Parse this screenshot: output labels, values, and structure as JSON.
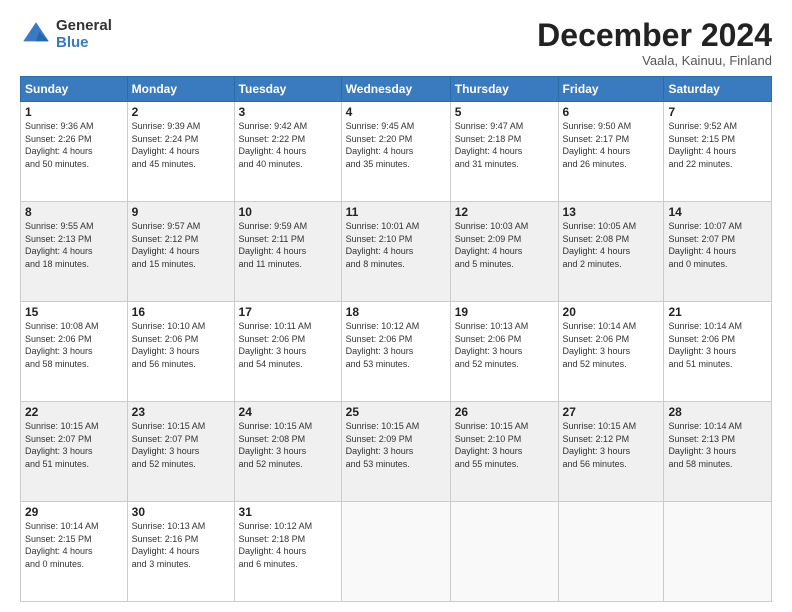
{
  "logo": {
    "general": "General",
    "blue": "Blue"
  },
  "title": "December 2024",
  "location": "Vaala, Kainuu, Finland",
  "headers": [
    "Sunday",
    "Monday",
    "Tuesday",
    "Wednesday",
    "Thursday",
    "Friday",
    "Saturday"
  ],
  "weeks": [
    [
      {
        "day": "1",
        "detail": "Sunrise: 9:36 AM\nSunset: 2:26 PM\nDaylight: 4 hours\nand 50 minutes."
      },
      {
        "day": "2",
        "detail": "Sunrise: 9:39 AM\nSunset: 2:24 PM\nDaylight: 4 hours\nand 45 minutes."
      },
      {
        "day": "3",
        "detail": "Sunrise: 9:42 AM\nSunset: 2:22 PM\nDaylight: 4 hours\nand 40 minutes."
      },
      {
        "day": "4",
        "detail": "Sunrise: 9:45 AM\nSunset: 2:20 PM\nDaylight: 4 hours\nand 35 minutes."
      },
      {
        "day": "5",
        "detail": "Sunrise: 9:47 AM\nSunset: 2:18 PM\nDaylight: 4 hours\nand 31 minutes."
      },
      {
        "day": "6",
        "detail": "Sunrise: 9:50 AM\nSunset: 2:17 PM\nDaylight: 4 hours\nand 26 minutes."
      },
      {
        "day": "7",
        "detail": "Sunrise: 9:52 AM\nSunset: 2:15 PM\nDaylight: 4 hours\nand 22 minutes."
      }
    ],
    [
      {
        "day": "8",
        "detail": "Sunrise: 9:55 AM\nSunset: 2:13 PM\nDaylight: 4 hours\nand 18 minutes."
      },
      {
        "day": "9",
        "detail": "Sunrise: 9:57 AM\nSunset: 2:12 PM\nDaylight: 4 hours\nand 15 minutes."
      },
      {
        "day": "10",
        "detail": "Sunrise: 9:59 AM\nSunset: 2:11 PM\nDaylight: 4 hours\nand 11 minutes."
      },
      {
        "day": "11",
        "detail": "Sunrise: 10:01 AM\nSunset: 2:10 PM\nDaylight: 4 hours\nand 8 minutes."
      },
      {
        "day": "12",
        "detail": "Sunrise: 10:03 AM\nSunset: 2:09 PM\nDaylight: 4 hours\nand 5 minutes."
      },
      {
        "day": "13",
        "detail": "Sunrise: 10:05 AM\nSunset: 2:08 PM\nDaylight: 4 hours\nand 2 minutes."
      },
      {
        "day": "14",
        "detail": "Sunrise: 10:07 AM\nSunset: 2:07 PM\nDaylight: 4 hours\nand 0 minutes."
      }
    ],
    [
      {
        "day": "15",
        "detail": "Sunrise: 10:08 AM\nSunset: 2:06 PM\nDaylight: 3 hours\nand 58 minutes."
      },
      {
        "day": "16",
        "detail": "Sunrise: 10:10 AM\nSunset: 2:06 PM\nDaylight: 3 hours\nand 56 minutes."
      },
      {
        "day": "17",
        "detail": "Sunrise: 10:11 AM\nSunset: 2:06 PM\nDaylight: 3 hours\nand 54 minutes."
      },
      {
        "day": "18",
        "detail": "Sunrise: 10:12 AM\nSunset: 2:06 PM\nDaylight: 3 hours\nand 53 minutes."
      },
      {
        "day": "19",
        "detail": "Sunrise: 10:13 AM\nSunset: 2:06 PM\nDaylight: 3 hours\nand 52 minutes."
      },
      {
        "day": "20",
        "detail": "Sunrise: 10:14 AM\nSunset: 2:06 PM\nDaylight: 3 hours\nand 52 minutes."
      },
      {
        "day": "21",
        "detail": "Sunrise: 10:14 AM\nSunset: 2:06 PM\nDaylight: 3 hours\nand 51 minutes."
      }
    ],
    [
      {
        "day": "22",
        "detail": "Sunrise: 10:15 AM\nSunset: 2:07 PM\nDaylight: 3 hours\nand 51 minutes."
      },
      {
        "day": "23",
        "detail": "Sunrise: 10:15 AM\nSunset: 2:07 PM\nDaylight: 3 hours\nand 52 minutes."
      },
      {
        "day": "24",
        "detail": "Sunrise: 10:15 AM\nSunset: 2:08 PM\nDaylight: 3 hours\nand 52 minutes."
      },
      {
        "day": "25",
        "detail": "Sunrise: 10:15 AM\nSunset: 2:09 PM\nDaylight: 3 hours\nand 53 minutes."
      },
      {
        "day": "26",
        "detail": "Sunrise: 10:15 AM\nSunset: 2:10 PM\nDaylight: 3 hours\nand 55 minutes."
      },
      {
        "day": "27",
        "detail": "Sunrise: 10:15 AM\nSunset: 2:12 PM\nDaylight: 3 hours\nand 56 minutes."
      },
      {
        "day": "28",
        "detail": "Sunrise: 10:14 AM\nSunset: 2:13 PM\nDaylight: 3 hours\nand 58 minutes."
      }
    ],
    [
      {
        "day": "29",
        "detail": "Sunrise: 10:14 AM\nSunset: 2:15 PM\nDaylight: 4 hours\nand 0 minutes."
      },
      {
        "day": "30",
        "detail": "Sunrise: 10:13 AM\nSunset: 2:16 PM\nDaylight: 4 hours\nand 3 minutes."
      },
      {
        "day": "31",
        "detail": "Sunrise: 10:12 AM\nSunset: 2:18 PM\nDaylight: 4 hours\nand 6 minutes."
      },
      {
        "day": "",
        "detail": ""
      },
      {
        "day": "",
        "detail": ""
      },
      {
        "day": "",
        "detail": ""
      },
      {
        "day": "",
        "detail": ""
      }
    ]
  ]
}
